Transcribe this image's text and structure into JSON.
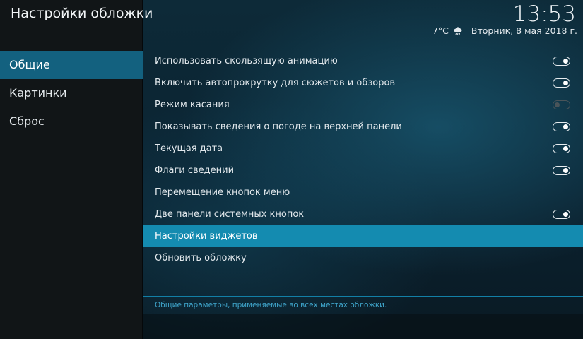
{
  "header": {
    "title": "Настройки обложки",
    "clock": "13:53",
    "temperature": "7°C",
    "weather_icon": "cloud-rain-icon",
    "date": "Вторник, 8 мая 2018 г."
  },
  "sidebar": {
    "items": [
      {
        "label": "Общие",
        "active": true
      },
      {
        "label": "Картинки",
        "active": false
      },
      {
        "label": "Сброс",
        "active": false
      }
    ]
  },
  "settings": {
    "items": [
      {
        "label": "Использовать скользящую анимацию",
        "toggle": "on"
      },
      {
        "label": "Включить автопрокрутку для сюжетов и обзоров",
        "toggle": "on"
      },
      {
        "label": "Режим касания",
        "toggle": "off"
      },
      {
        "label": "Показывать сведения о погоде на верхней панели",
        "toggle": "on"
      },
      {
        "label": "Текущая дата",
        "toggle": "on"
      },
      {
        "label": "Флаги сведений",
        "toggle": "on"
      },
      {
        "label": "Перемещение кнопок меню",
        "toggle": null
      },
      {
        "label": "Две панели системных кнопок",
        "toggle": "on"
      },
      {
        "label": "Настройки виджетов",
        "toggle": null,
        "focused": true
      },
      {
        "label": "Обновить обложку",
        "toggle": null
      }
    ]
  },
  "footer": {
    "hint": "Общие параметры, применяемые во всех местах обложки."
  },
  "colors": {
    "accent": "#148bb0",
    "sidebar_active": "#13617f",
    "hint_text": "#3fa6cc"
  }
}
